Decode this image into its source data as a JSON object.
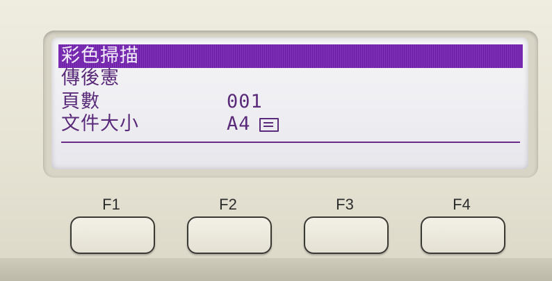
{
  "display": {
    "title": "彩色掃描",
    "menu": [
      {
        "label": "傳後憲",
        "value": ""
      },
      {
        "label": "頁數",
        "value": "001"
      },
      {
        "label": "文件大小",
        "value": "A4",
        "icon": "paper-tray-icon"
      }
    ]
  },
  "function_keys": [
    "F1",
    "F2",
    "F3",
    "F4"
  ],
  "colors": {
    "lcd_text": "#5a2a7a",
    "highlight": "#7e2fb8",
    "lcd_background": "#f0f0f4",
    "panel": "#e6e3d4"
  }
}
